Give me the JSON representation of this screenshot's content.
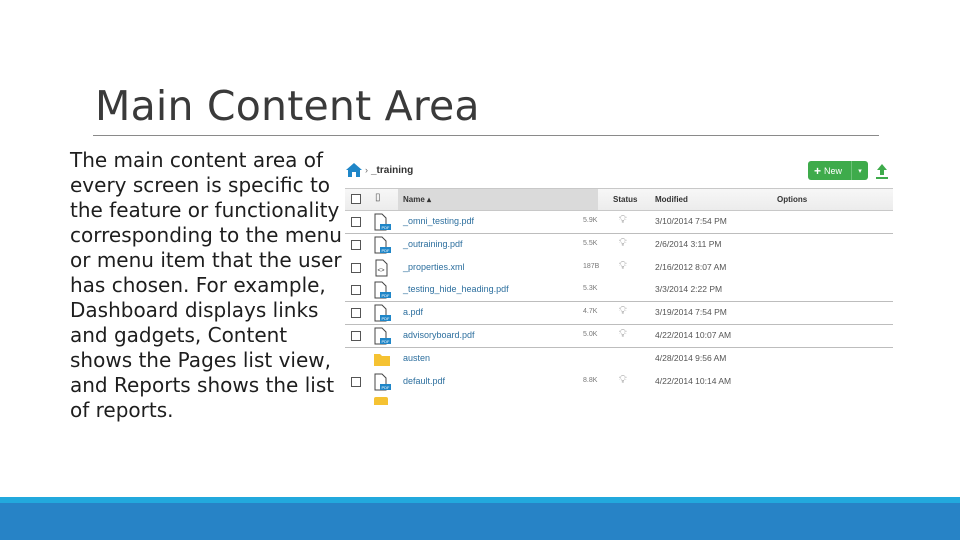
{
  "slide": {
    "title": "Main Content Area",
    "body": "The main content area of every screen is specific to the feature or functionality corresponding to the menu or menu item that the user has chosen. For example, Dashboard displays links and gadgets, Content shows the Pages list view, and Reports shows the list of reports."
  },
  "colors": {
    "accent_green": "#3eab4b",
    "link_blue": "#2d6f9e",
    "footer_strip": "#22a9dd",
    "footer_band": "#2783c6",
    "folder_yellow": "#f5c232"
  },
  "app": {
    "breadcrumb": {
      "home_icon": "home-icon",
      "separator": "›",
      "current": "_training"
    },
    "toolbar": {
      "new_label": "New",
      "new_icon": "plus-icon",
      "dropdown_icon": "caret-down-icon",
      "upload_icon": "upload-icon"
    },
    "table": {
      "columns": {
        "name": "Name ▴",
        "status": "Status",
        "modified": "Modified",
        "options": "Options"
      },
      "rows": [
        {
          "type": "pdf",
          "name": "_omni_testing.pdf",
          "size": "5.9K",
          "status": "lightbulb",
          "modified": "3/10/2014 7:54 PM",
          "checkbox": true
        },
        {
          "type": "pdf",
          "name": "_outraining.pdf",
          "size": "5.5K",
          "status": "lightbulb",
          "modified": "2/6/2014 3:11 PM",
          "checkbox": true
        },
        {
          "type": "xml",
          "name": "_properties.xml",
          "size": "187B",
          "status": "lightbulb",
          "modified": "2/16/2012 8:07 AM",
          "checkbox": true
        },
        {
          "type": "pdf",
          "name": "_testing_hide_heading.pdf",
          "size": "5.3K",
          "status": "",
          "modified": "3/3/2014 2:22 PM",
          "checkbox": true
        },
        {
          "type": "pdf",
          "name": "a.pdf",
          "size": "4.7K",
          "status": "lightbulb",
          "modified": "3/19/2014 7:54 PM",
          "checkbox": true
        },
        {
          "type": "pdf",
          "name": "advisoryboard.pdf",
          "size": "5.0K",
          "status": "lightbulb",
          "modified": "4/22/2014 10:07 AM",
          "checkbox": true
        },
        {
          "type": "folder",
          "name": "austen",
          "size": "",
          "status": "",
          "modified": "4/28/2014 9:56 AM",
          "checkbox": false
        },
        {
          "type": "pdf",
          "name": "default.pdf",
          "size": "8.8K",
          "status": "lightbulb",
          "modified": "4/22/2014 10:14 AM",
          "checkbox": true
        }
      ]
    }
  }
}
